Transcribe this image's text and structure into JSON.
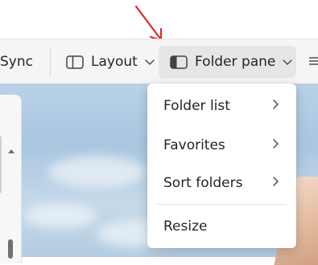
{
  "toolbar": {
    "sync_label": "Sync",
    "layout_label": "Layout",
    "folder_pane_label": "Folder pane"
  },
  "folder_pane_menu": {
    "items": [
      {
        "label": "Folder list",
        "has_submenu": true
      },
      {
        "label": "Favorites",
        "has_submenu": true
      },
      {
        "label": "Sort folders",
        "has_submenu": true
      },
      {
        "label": "Resize",
        "has_submenu": false
      }
    ]
  },
  "icons": {
    "layout": "layout-icon",
    "folder_pane": "folder-pane-icon",
    "dropdown": "chevron-down-icon",
    "submenu": "chevron-right-icon",
    "more": "more-icon",
    "annotation": "arrow-annotation-icon"
  },
  "colors": {
    "annotation_arrow": "#e0282c",
    "active_button_bg": "#e6e6e6",
    "ribbon_bg": "#f5f5f5"
  }
}
